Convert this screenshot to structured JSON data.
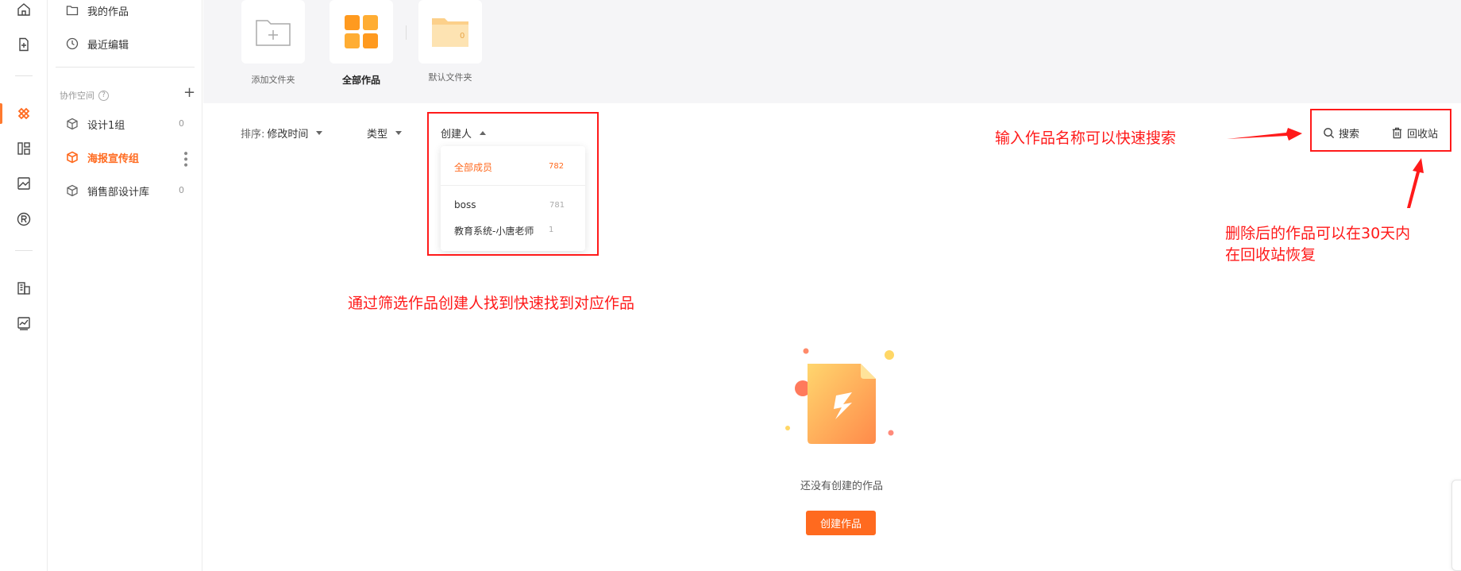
{
  "rail": {
    "icons": [
      "home-icon",
      "new-file-icon",
      "workspace-icon",
      "layout-icon",
      "image-icon",
      "registered-icon",
      "building-icon",
      "chart-icon"
    ]
  },
  "sidebar": {
    "my_works": "我的作品",
    "recent_edits": "最近编辑",
    "section_title": "协作空间",
    "help": "?",
    "add": "+",
    "groups": [
      {
        "label": "设计1组",
        "count": "0"
      },
      {
        "label": "海报宣传组",
        "count": ""
      },
      {
        "label": "销售部设计库",
        "count": "0"
      }
    ]
  },
  "folders": {
    "add_folder": "添加文件夹",
    "all_works": "全部作品",
    "default_folder": "默认文件夹",
    "default_folder_count": "0"
  },
  "filters": {
    "sort_label": "排序:",
    "sort_value": "修改时间",
    "type": "类型",
    "creator": "创建人"
  },
  "dropdown": {
    "items": [
      {
        "label": "全部成员",
        "count": "782"
      },
      {
        "label": "boss",
        "count": "781"
      },
      {
        "label": "教育系统-小唐老师",
        "count": "1"
      }
    ]
  },
  "tools": {
    "search": "搜索",
    "recycle": "回收站"
  },
  "annotations": {
    "search_hint": "输入作品名称可以快速搜索",
    "recycle_hint_line1": "删除后的作品可以在30天内",
    "recycle_hint_line2": "在回收站恢复",
    "filter_hint": "通过筛选作品创建人找到快速找到对应作品"
  },
  "empty_state": {
    "message": "还没有创建的作品",
    "button": "创建作品"
  },
  "colors": {
    "accent": "#ff6a1f",
    "annotation_red": "#ff1a1a"
  }
}
